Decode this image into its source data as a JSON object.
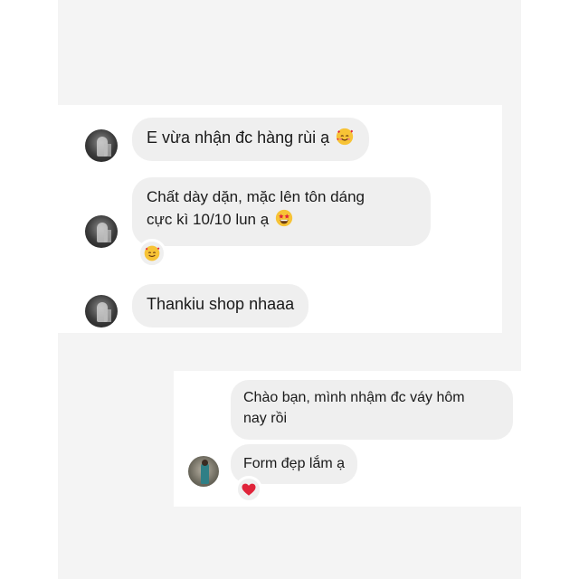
{
  "chat1": {
    "messages": [
      {
        "text": "E vừa nhận đc hàng rùi ạ",
        "emoji": "smiling-face-with-hearts-icon"
      },
      {
        "text": "Chất dày dặn, mặc lên tôn dáng\ncực kì 10/10 lun ạ",
        "emoji": "star-struck-icon",
        "reaction": "smiling-face-with-hearts-icon"
      },
      {
        "text": "Thankiu shop nhaaa"
      }
    ]
  },
  "chat2": {
    "messages": [
      {
        "text": "Chào bạn, mình nhậm đc váy hôm\nnay rồi"
      },
      {
        "text": "Form đẹp lắm ạ",
        "reaction": "red-heart-icon"
      }
    ]
  },
  "colors": {
    "bubble": "#efefef",
    "background": "#f4f4f4",
    "text": "#1a1a1a",
    "heart": "#e0243a",
    "emoji_yellow": "#f7c336"
  }
}
